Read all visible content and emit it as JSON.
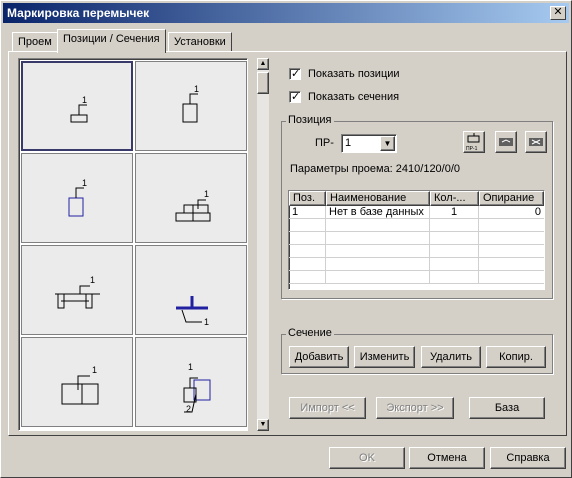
{
  "window": {
    "title": "Маркировка перемычек",
    "close_glyph": "✕"
  },
  "tabs": [
    {
      "label": "Проем",
      "active": false
    },
    {
      "label": "Позиции / Сечения",
      "active": true
    },
    {
      "label": "Установки",
      "active": false
    }
  ],
  "grid": {
    "cells": [
      {
        "label": "1",
        "shape": "small-rect-leader",
        "selected": true
      },
      {
        "label": "1",
        "shape": "tall-rect-leader",
        "selected": false
      },
      {
        "label": "1",
        "shape": "blue-rect-leader",
        "selected": false
      },
      {
        "label": "1",
        "shape": "stepped-rect-leader",
        "selected": false
      },
      {
        "label": "1",
        "shape": "beam-with-supports",
        "selected": false
      },
      {
        "label": "1",
        "shape": "blue-t-section",
        "selected": false
      },
      {
        "label": "1",
        "shape": "double-rect-leader",
        "selected": false
      },
      {
        "labels": [
          "1",
          "2"
        ],
        "shape": "combo-section-blue",
        "selected": false
      }
    ]
  },
  "scroll": {
    "up_glyph": "▲",
    "down_glyph": "▼"
  },
  "checkboxes": {
    "show_positions": {
      "label": "Показать позиции",
      "checked": true
    },
    "show_sections": {
      "label": "Показать сечения",
      "checked": true
    }
  },
  "position_group": {
    "title": "Позиция",
    "pr_label": "ПР-",
    "pr_value": "1",
    "combo_glyph": "▼",
    "icon_buttons": [
      {
        "icon": "pr-1-stamp-icon",
        "caption": "ПР-1"
      },
      {
        "icon": "arrow-section-icon"
      },
      {
        "icon": "cross-section-icon"
      }
    ],
    "opening_params": "Параметры проема:  2410/120/0/0",
    "table": {
      "headers": [
        "Поз.",
        "Наименование",
        "Кол-...",
        "Опирание"
      ],
      "rows": [
        [
          "1",
          "Нет в базе данных",
          "1",
          "0"
        ]
      ]
    }
  },
  "section_group": {
    "title": "Сечение",
    "buttons": [
      "Добавить",
      "Изменить",
      "Удалить",
      "Копир."
    ]
  },
  "io_buttons": {
    "import": "Импорт <<",
    "export": "Экспорт >>",
    "base": "База"
  },
  "footer": {
    "ok": "OK",
    "cancel": "Отмена",
    "help": "Справка"
  },
  "colors": {
    "title_start": "#0a246a",
    "title_end": "#a6caf0",
    "accent_blue": "#2020a0",
    "face": "#d4d0c8"
  }
}
